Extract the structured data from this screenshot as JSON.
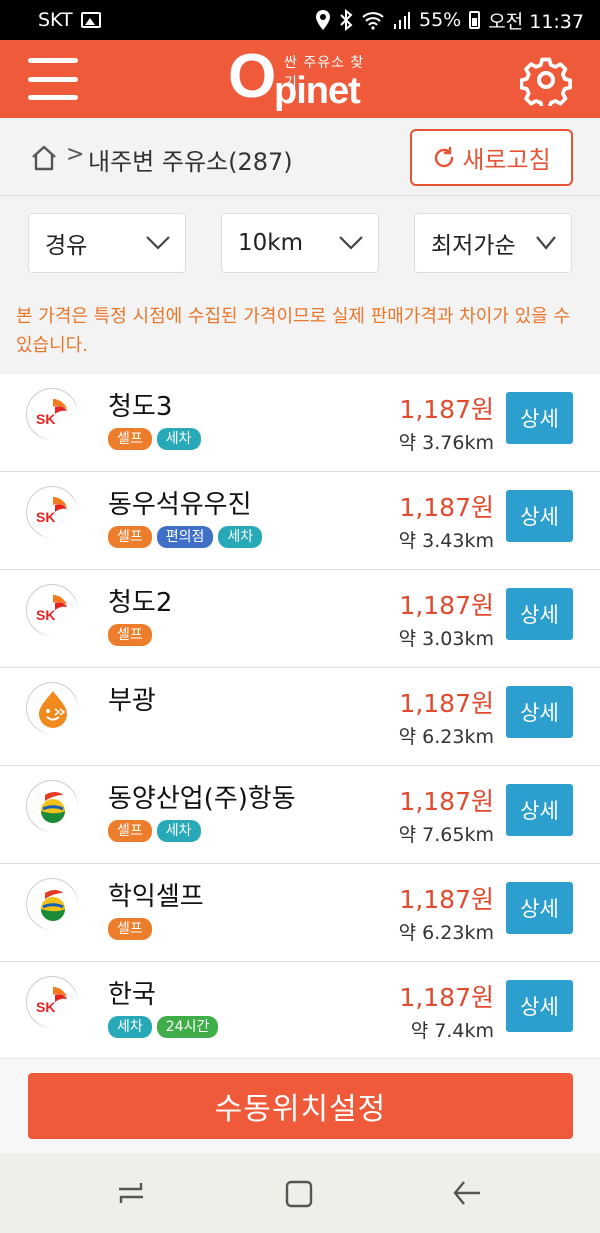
{
  "status_bar": {
    "carrier": "SKT",
    "battery": "55%",
    "time": "오전 11:37"
  },
  "header": {
    "logo_tag": "싼 주유소 찾기",
    "logo_o": "O",
    "logo_word": "pinet"
  },
  "breadcrumb": {
    "separator": ">",
    "title": "내주변 주유소(287)"
  },
  "refresh_label": "새로고침",
  "filters": {
    "fuel": "경유",
    "radius": "10km",
    "sort": "최저가순"
  },
  "notice": "본 가격은 특정 시점에 수집된 가격이므로 실제 판매가격과 차이가 있을 수 있습니다.",
  "detail_label": "상세",
  "stations": [
    {
      "name": "청도3",
      "brand": "SK",
      "price": "1,187원",
      "distance": "약 3.76km",
      "badges": [
        "셀프",
        "세차"
      ]
    },
    {
      "name": "동우석유우진",
      "brand": "SK",
      "price": "1,187원",
      "distance": "약 3.43km",
      "badges": [
        "셀프",
        "편의점",
        "세차"
      ]
    },
    {
      "name": "청도2",
      "brand": "SK",
      "price": "1,187원",
      "distance": "약 3.03km",
      "badges": [
        "셀프"
      ]
    },
    {
      "name": "부광",
      "brand": "S-OIL",
      "price": "1,187원",
      "distance": "약 6.23km",
      "badges": []
    },
    {
      "name": "동양산업(주)항동",
      "brand": "HYUNDAI",
      "price": "1,187원",
      "distance": "약 7.65km",
      "badges": [
        "셀프",
        "세차"
      ]
    },
    {
      "name": "학익셀프",
      "brand": "HYUNDAI",
      "price": "1,187원",
      "distance": "약 6.23km",
      "badges": [
        "셀프"
      ]
    },
    {
      "name": "한국",
      "brand": "SK",
      "price": "1,187원",
      "distance": "약 7.4km",
      "badges": [
        "세차",
        "24시간"
      ]
    }
  ],
  "manual_location_label": "수동위치설정",
  "colors": {
    "accent": "#ef5a3a",
    "price": "#e04a2e",
    "detail": "#2c9fcf",
    "notice": "#e8762b",
    "badge_self": "#ec7d2b",
    "badge_wash": "#27a9b7",
    "badge_store": "#3f6fc7",
    "badge_24h": "#3fae49"
  },
  "icons": {
    "menu": "hamburger-icon",
    "settings": "gear-icon",
    "home": "home-icon",
    "refresh": "refresh-icon",
    "dropdown": "chevron-down-icon"
  }
}
